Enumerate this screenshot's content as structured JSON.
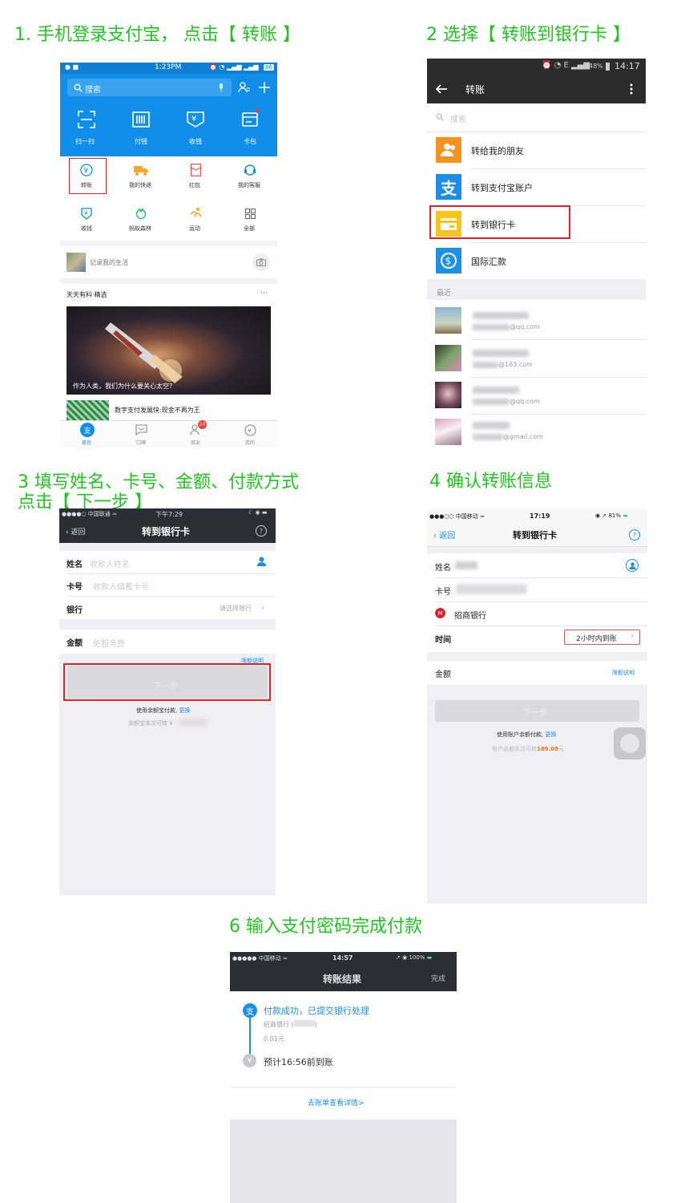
{
  "steps": {
    "s1": "1. 手机登录支付宝， 点击【 转账 】",
    "s2": "2 选择【 转账到银行卡 】",
    "s3a": "3 填写姓名、卡号、金额、付款方式",
    "s3b": "点击【 下一步 】",
    "s4": "4 确认转账信息",
    "s6": "6 输入支付密码完成付款"
  },
  "p1": {
    "status_time": "1:23PM",
    "status_badge": "86",
    "search_placeholder": "搜索",
    "top_actions": [
      "扫一扫",
      "付钱",
      "收钱",
      "卡包"
    ],
    "grid_row1": [
      "转账",
      "我的快递",
      "红包",
      "我的客服"
    ],
    "grid_row2": [
      "收钱",
      "蚂蚁森林",
      "运动",
      "全部"
    ],
    "life_text": "记录我的生活",
    "feed_header": "天天有料·精选",
    "feed_more": "···",
    "feed_caption": "作为人类，我们为什么要关心太空?",
    "news_title": "数字支付发展快:现金不再为王",
    "tabs": [
      "首页",
      "口碑",
      "朋友",
      "我的"
    ],
    "friends_badge": "24",
    "colors": {
      "brand": "#108ee9"
    }
  },
  "p2": {
    "status_text": "48%",
    "status_time": "14:17",
    "title": "转账",
    "search_placeholder": "搜索",
    "options": [
      "转给我的朋友",
      "转到支付宝账户",
      "转到银行卡",
      "国际汇款"
    ],
    "section_recent": "最近",
    "contacts": [
      "@qq.com",
      "@163.com",
      "@qq.com",
      "@gmail.com"
    ]
  },
  "p3": {
    "carrier": "中国联通",
    "status_time": "下午7:29",
    "back": "返回",
    "title": "转到银行卡",
    "help": "?",
    "name_label": "姓名",
    "name_placeholder": "收款人姓名",
    "card_label": "卡号",
    "card_placeholder": "收款人储蓄卡号",
    "bank_label": "银行",
    "bank_placeholder": "请选择银行",
    "amount_label": "金额",
    "amount_placeholder": "免服务费",
    "limit_link": "限额说明",
    "next_button": "下一步",
    "pay_method": "使用余额宝付款,",
    "change": "更换",
    "balance_note": "余额宝本次可转 ¥"
  },
  "p4": {
    "carrier": "中国移动",
    "status_time": "17:19",
    "battery": "81%",
    "back": "返回",
    "title": "转到银行卡",
    "help": "?",
    "name_label": "姓名",
    "card_label": "卡号",
    "bank_name": "招商银行",
    "time_label": "时间",
    "time_value": "2小时内到账",
    "amount_label": "金额",
    "limit_link": "限额说明",
    "next_button": "下一步",
    "pay_method": "使用账户余额付款,",
    "change": "更换",
    "balance_prefix": "账户余额本次可转",
    "balance_value": "189.08",
    "balance_unit": "元"
  },
  "p6": {
    "carrier": "中国移动",
    "status_time": "14:57",
    "battery": "100%",
    "title": "转账结果",
    "done": "完成",
    "success_text": "付款成功，已提交银行处理",
    "bank_line": "招商银行 (",
    "bank_suffix": ")",
    "amount": "0.01元",
    "eta": "预计16:56前到账",
    "detail_link": "去账单查看详情>"
  }
}
